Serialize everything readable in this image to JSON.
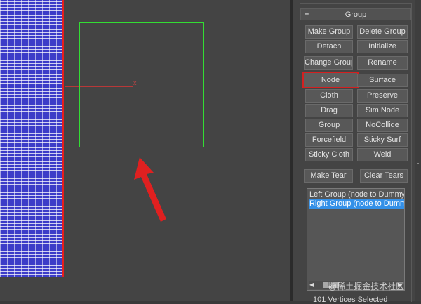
{
  "viewport": {
    "axis_label": "x",
    "colors": {
      "mesh": "#3c3cc8",
      "mesh_edge": "#e81e1e",
      "gizmo": "#33dd33",
      "arrow": "#e02020"
    }
  },
  "panel": {
    "rollout": {
      "toggle": "–",
      "title": "Group"
    },
    "buttons": {
      "make_group": "Make Group",
      "delete_group": "Delete Group",
      "detach": "Detach",
      "initialize": "Initialize",
      "change_group": "Change Group",
      "rename": "Rename",
      "node": "Node",
      "surface": "Surface",
      "cloth": "Cloth",
      "preserve": "Preserve",
      "drag": "Drag",
      "sim_node": "Sim Node",
      "group": "Group",
      "nocollide": "NoCollide",
      "forcefield": "Forcefield",
      "sticky_surf": "Sticky Surf",
      "sticky_cloth": "Sticky Cloth",
      "weld": "Weld",
      "make_tear": "Make Tear",
      "clear_tears": "Clear Tears"
    },
    "group_list": {
      "items": [
        "Left Group (node  to  Dummy",
        "Right Group (node  to  Dumm"
      ],
      "selected_index": 1,
      "scroll_left": "◀",
      "scroll_right": "▶"
    },
    "status": "101 Vertices Selected"
  },
  "watermark": "@稀土掘金技术社区"
}
